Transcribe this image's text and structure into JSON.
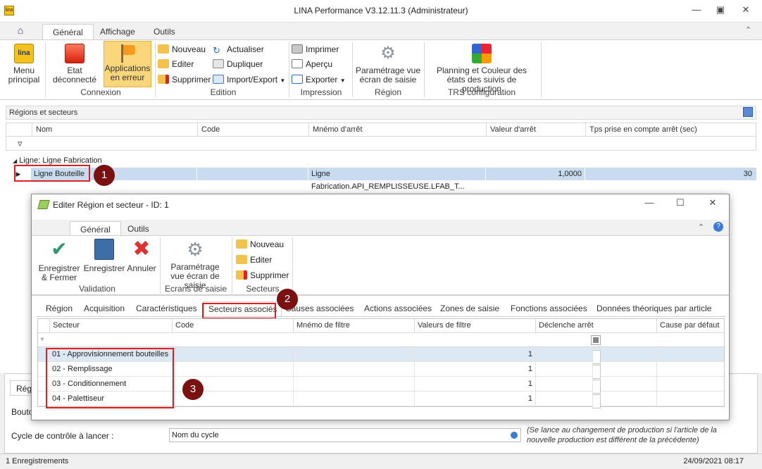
{
  "app": {
    "title": "LINA Performance  V3.12.11.3  (Administrateur)"
  },
  "main_tabs": [
    "Général",
    "Affichage",
    "Outils"
  ],
  "ribbon": {
    "menu_principal": "Menu principal",
    "etat": "Etat déconnecté",
    "applications": "Applications en erreur",
    "connexion": "Connexion",
    "nouveau": "Nouveau",
    "editer": "Editer",
    "supprimer": "Supprimer",
    "actualiser": "Actualiser",
    "dupliquer": "Dupliquer",
    "import_export": "Import/Export",
    "edition": "Edition",
    "imprimer": "Imprimer",
    "apercu": "Aperçu",
    "exporter": "Exporter",
    "impression": "Impression",
    "parametrage": "Paramétrage vue écran de saisie",
    "region": "Région",
    "planning": "Planning et Couleur des états des suivis de production",
    "trs": "TRS configuration"
  },
  "panel": {
    "title": "Régions et secteurs"
  },
  "grid": {
    "columns": [
      "Nom",
      "Code",
      "Mnémo d'arrêt",
      "Valeur d'arrêt",
      "Tps prise en compte arrêt (sec)"
    ],
    "group": "Ligne: Ligne Fabrication",
    "row": {
      "nom": "Ligne Bouteille",
      "code": "",
      "mnemo": "Ligne Fabrication.API_REMPLISSEUSE.LFAB_T...",
      "valeur": "1,0000",
      "tps": "30"
    }
  },
  "badges": [
    "1",
    "2",
    "3"
  ],
  "dialog": {
    "title": "Editer Région et secteur - ID: 1",
    "tabs": [
      "Général",
      "Outils"
    ],
    "enregistrer_fermer": "Enregistrer & Fermer",
    "enregistrer": "Enregistrer",
    "annuler": "Annuler",
    "validation": "Validation",
    "parametrage": "Paramétrage vue écran de saisie",
    "ecrans": "Ecrans de saisie",
    "nouveau": "Nouveau",
    "editer": "Editer",
    "supprimer": "Supprimer",
    "secteurs": "Secteurs",
    "page_tabs": [
      "Région",
      "Acquisition",
      "Caractéristiques",
      "Secteurs associés",
      "Causes associées",
      "Actions associées",
      "Zones de saisie",
      "Fonctions associées",
      "Données théoriques par article"
    ],
    "columns": [
      "Secteur",
      "Code",
      "Mnémo de filtre",
      "Valeurs de filtre",
      "Déclenche arrêt",
      "Cause par défaut"
    ],
    "rows": [
      {
        "secteur": "01 - Approvisionnement bouteilles",
        "valeur": "1"
      },
      {
        "secteur": "02 - Remplissage",
        "valeur": "1"
      },
      {
        "secteur": "03 - Conditionnement",
        "valeur": "1"
      },
      {
        "secteur": "04 - Palettiseur",
        "valeur": "1"
      }
    ]
  },
  "bottom": {
    "tab_partial": "Régi",
    "bouton_partial": "Bouto",
    "cycle_label": "Cycle de contrôle à lancer :",
    "cycle_value": "Nom du cycle",
    "note": "(Se lance au changement de production si l'article de la nouvelle production est différent de la précédente)"
  },
  "status": {
    "left": "1 Enregistrements",
    "right": "24/09/2021 08:17"
  }
}
